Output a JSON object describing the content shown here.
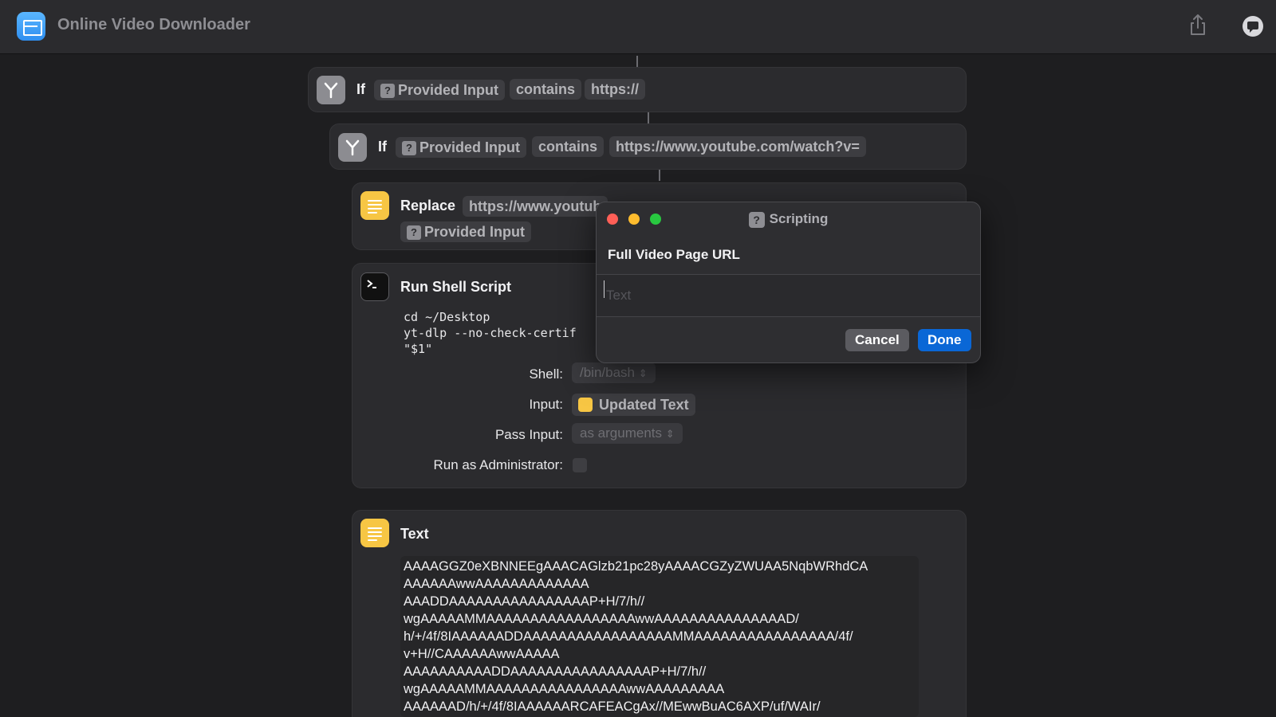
{
  "app": {
    "title": "Online Video Downloader"
  },
  "colors": {
    "accent": "#0a67d6",
    "yellow": "#f7c644",
    "background": "#1e1e20"
  },
  "if1": {
    "keyword": "If",
    "variable": "Provided Input",
    "operator": "contains",
    "value": "https://"
  },
  "if2": {
    "keyword": "If",
    "variable": "Provided Input",
    "operator": "contains",
    "value": "https://www.youtube.com/watch?v="
  },
  "replace": {
    "label": "Replace",
    "value": "https://www.youtub",
    "input": "Provided Input"
  },
  "shell": {
    "title": "Run Shell Script",
    "code": [
      "cd ~/Desktop",
      "yt-dlp --no-check-certif",
      "\"$1\""
    ],
    "shell_label": "Shell:",
    "shell_value": "/bin/bash",
    "input_label": "Input:",
    "input_value": "Updated Text",
    "pass_label": "Pass Input:",
    "pass_value": "as arguments",
    "admin_label": "Run as Administrator:"
  },
  "text_action": {
    "title": "Text",
    "lines": [
      "AAAAGGZ0eXBNNEEgAAACAGlzb21pc28yAAAACGZyZWUAA5NqbWRhdCA",
      "AAAAAAwwAAAAAAAAAAAAA",
      "AAADDAAAAAAAAAAAAAAAAP+H/7/h//",
      "wgAAAAAMMAAAAAAAAAAAAAAAAAwwAAAAAAAAAAAAAAAD/",
      "h/+/4f/8IAAAAAADDAAAAAAAAAAAAAAAAAMMAAAAAAAAAAAAAAAA/4f/",
      "v+H//CAAAAAAwwAAAAA",
      "AAAAAAAAAADDAAAAAAAAAAAAAAAAP+H/7/h//",
      "wgAAAAAMMAAAAAAAAAAAAAAAAwwAAAAAAAAA",
      "AAAAAAD/h/+/4f/8IAAAAAARCAFEACgAx//MEwwBuAC6AXP/uf/WAIr/"
    ]
  },
  "dialog": {
    "title": "Scripting",
    "prompt": "Full Video Page URL",
    "placeholder": "Text",
    "cancel": "Cancel",
    "done": "Done"
  }
}
